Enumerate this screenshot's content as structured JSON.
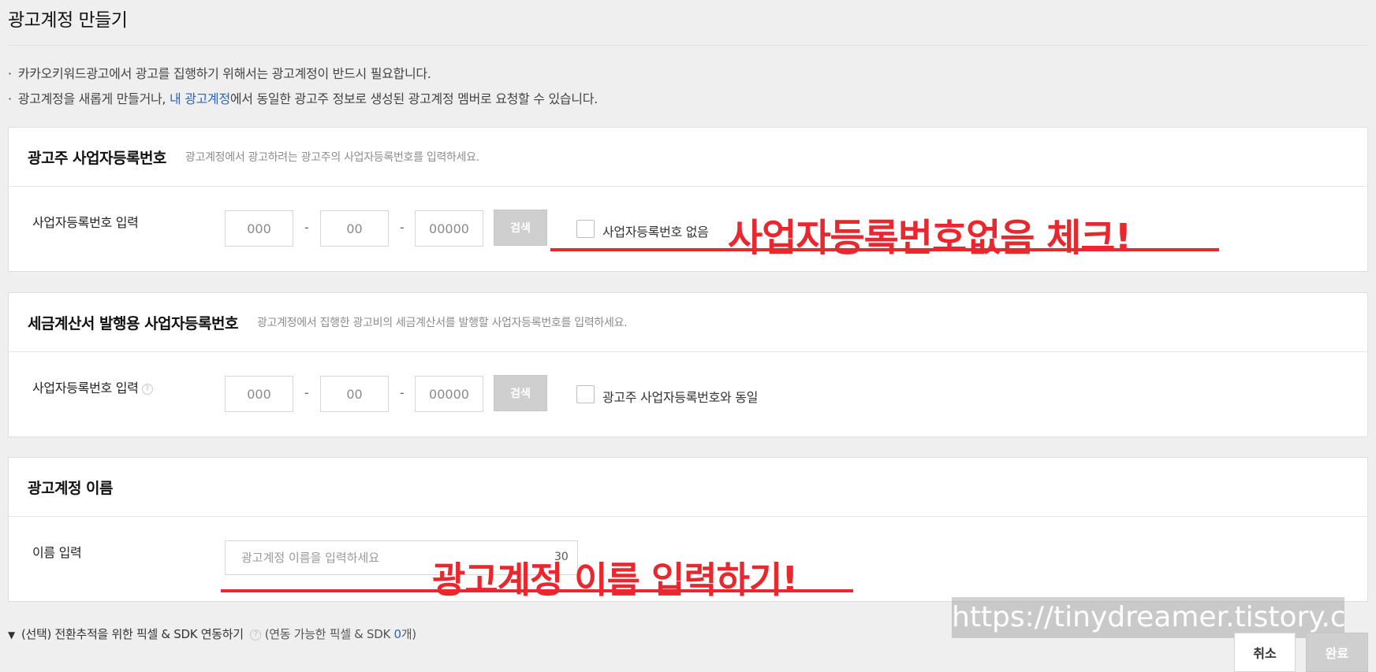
{
  "page": {
    "title": "광고계정 만들기"
  },
  "notices": {
    "line1": "카카오키워드광고에서 광고를 집행하기 위해서는 광고계정이 반드시 필요합니다.",
    "line2_pre": "광고계정을 새롭게 만들거나, ",
    "line2_link": "내 광고계정",
    "line2_post": "에서 동일한 광고주 정보로 생성된 광고계정 멤버로 요청할 수 있습니다."
  },
  "advertiser_section": {
    "title": "광고주 사업자등록번호",
    "description": "광고계정에서 광고하려는 광고주의 사업자등록번호를 입력하세요.",
    "field_label": "사업자등록번호 입력",
    "placeholders": [
      "000",
      "00",
      "00000"
    ],
    "dash": "-",
    "search_label": "검색",
    "checkbox_label": "사업자등록번호 없음"
  },
  "tax_section": {
    "title": "세금계산서 발행용 사업자등록번호",
    "description": "광고계정에서 집행한 광고비의 세금계산서를 발행할 사업자등록번호를 입력하세요.",
    "field_label": "사업자등록번호 입력",
    "help": "?",
    "placeholders": [
      "000",
      "00",
      "00000"
    ],
    "dash": "-",
    "search_label": "검색",
    "checkbox_label": "광고주 사업자등록번호와 동일"
  },
  "name_section": {
    "title": "광고계정 이름",
    "field_label": "이름 입력",
    "placeholder": "광고계정 이름을 입력하세요",
    "max_count": "30"
  },
  "annotations": {
    "check": "사업자등록번호없음 체크!",
    "name": "광고계정 이름 입력하기!"
  },
  "watermark": "https://tinydreamer.tistory.com",
  "pixel_sdk": {
    "label": "(선택) 전환추적을 위한 픽셀 & SDK 연동하기",
    "help": "?",
    "sub_pre": "(연동 가능한 픽셀 & SDK ",
    "count": "0",
    "sub_post": "개)"
  },
  "footer": {
    "cancel_label": "취소",
    "done_label": "완료"
  },
  "colors": {
    "link": "#2a63c9",
    "annotation_red": "#e8282e",
    "disabled_button": "#cfcfcf"
  }
}
